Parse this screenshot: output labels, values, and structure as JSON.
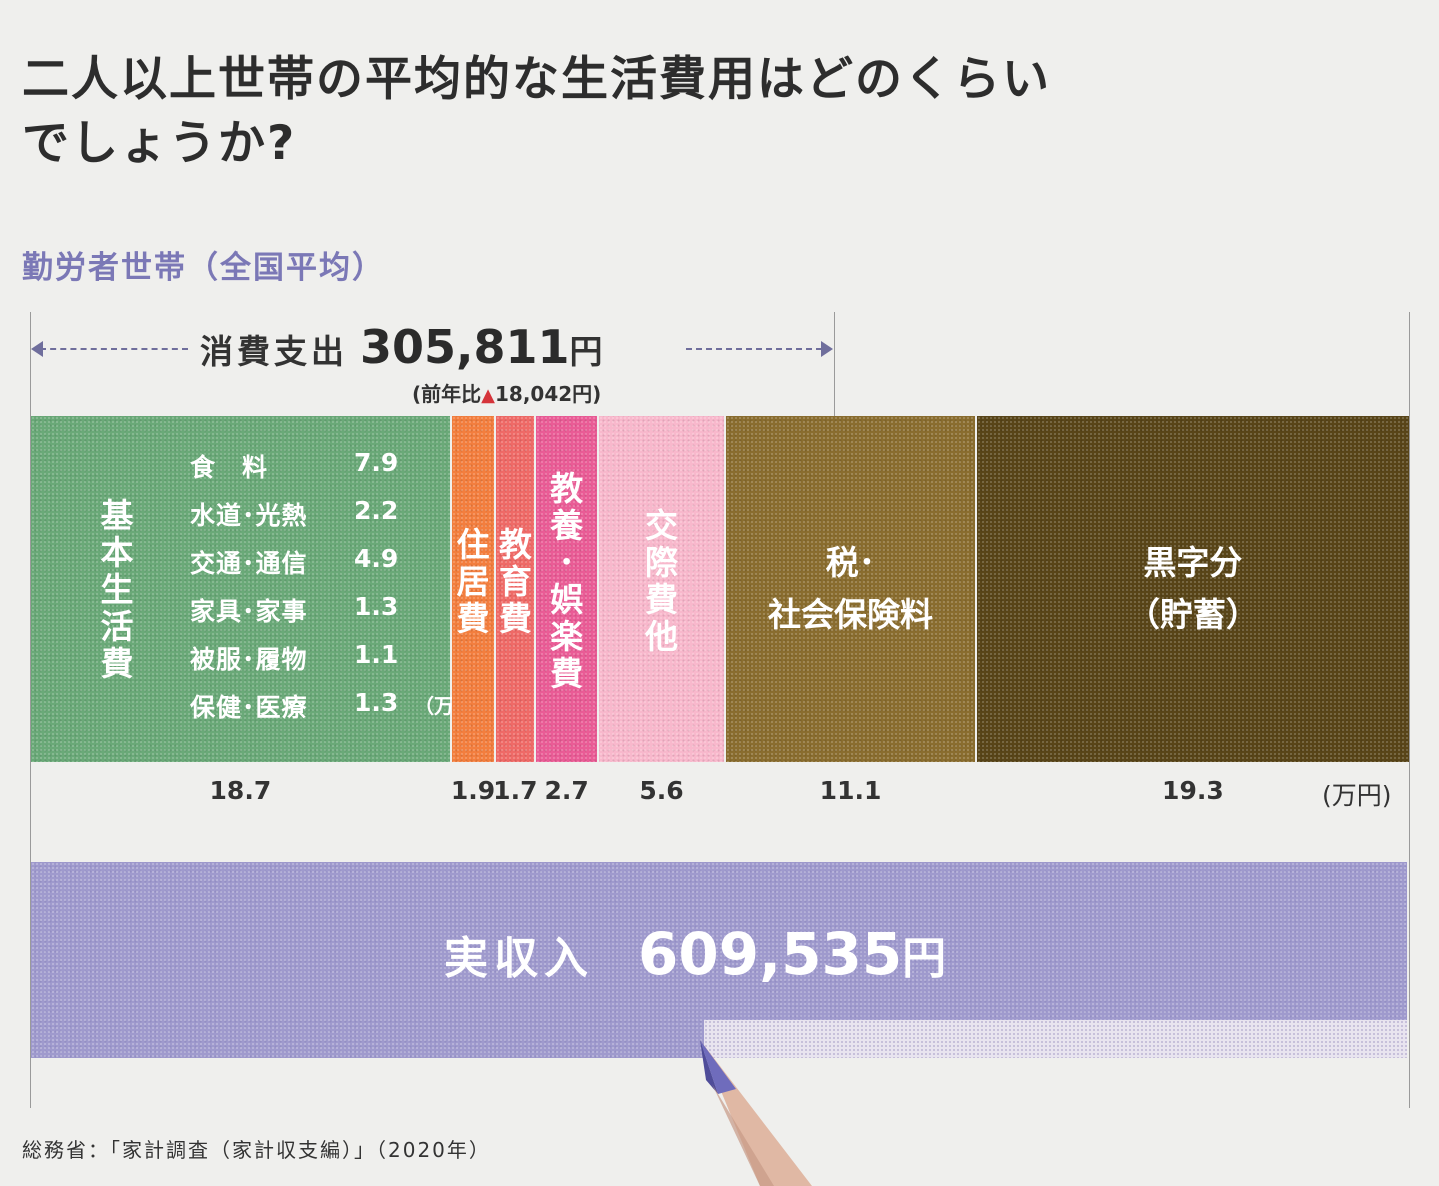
{
  "title": {
    "line1": "二人以上世帯の平均的な生活費用はどのくらい",
    "line2": "でしょうか?"
  },
  "subtitle": "勤労者世帯（全国平均）",
  "spending": {
    "label": "消費支出",
    "value": "305,811",
    "unit": "円",
    "diff_prefix": "(前年比",
    "diff_mark": "▲",
    "diff_value": "18,042円)"
  },
  "chart_data": {
    "type": "bar",
    "orientation": "horizontal-stacked",
    "unit": "(万円)",
    "segments": [
      {
        "label": "基本生活費",
        "value": 18.7,
        "value_label": "18.7",
        "color": "#6aa978",
        "breakdown": [
          {
            "name": "食　料",
            "value": "7.9"
          },
          {
            "name": "水道･光熱",
            "value": "2.2"
          },
          {
            "name": "交通･通信",
            "value": "4.9"
          },
          {
            "name": "家具･家事",
            "value": "1.3"
          },
          {
            "name": "被服･履物",
            "value": "1.1"
          },
          {
            "name": "保健･医療",
            "value": "1.3"
          }
        ],
        "breakdown_unit": "（万円）"
      },
      {
        "label": "住居費",
        "value": 1.9,
        "value_label": "1.9",
        "color": "#f37e3e"
      },
      {
        "label": "教育費",
        "value": 1.7,
        "value_label": "1.7",
        "color": "#ef6a67"
      },
      {
        "label": "教養･娯楽費",
        "value": 2.7,
        "value_label": "2.7",
        "color": "#ea5c96"
      },
      {
        "label": "交際費他",
        "value": 5.6,
        "value_label": "5.6",
        "color": "#f8b8cc"
      },
      {
        "label": "税･\n社会保険料",
        "value": 11.1,
        "value_label": "11.1",
        "color": "#8a6d2f"
      },
      {
        "label": "黒字分\n（貯蓄）",
        "value": 19.3,
        "value_label": "19.3",
        "color": "#594518"
      }
    ],
    "income": {
      "label": "実収入",
      "value": "609,535",
      "unit": "円",
      "color": "#9f9acd"
    }
  },
  "source": "総務省：「家計調査（家計収支編）」（2020年）"
}
